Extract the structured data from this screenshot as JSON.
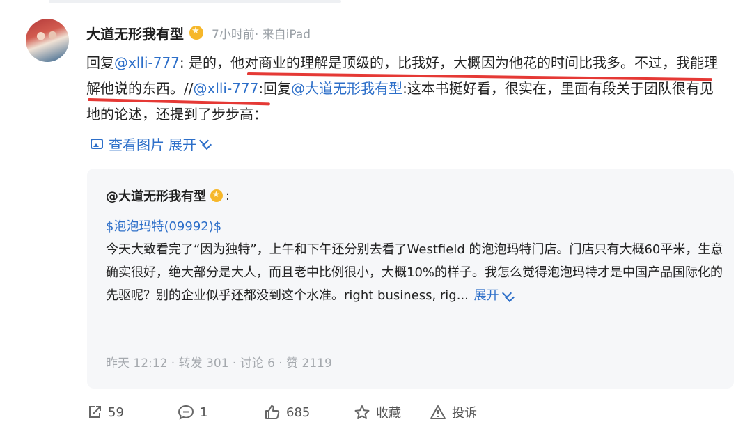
{
  "post": {
    "author": "大道无形我有型",
    "meta": "7小时前· 来自iPad",
    "reply_prefix": "回复",
    "mention_1": "@xlli-777",
    "text_1": ": 是的，",
    "underlined_1": "他对商业的理解是顶级的，比我好，大概因为他花的时间比我多。",
    "underlined_2": "不过，我能理解他说的东西",
    "text_2": "。//",
    "mention_2": "@xlli-777",
    "text_3": ":回复",
    "mention_3": "@大道无形我有型",
    "text_4": ":这本书挺好看，很实在，里面有段关于团队很有见地的论述，还提到了步步高：",
    "view_images": "查看图片",
    "expand": "展开"
  },
  "quoted": {
    "author": "@大道无形我有型",
    "colon": ":",
    "stock_tag": "$泡泡玛特(09992)$",
    "body": "今天大致看完了“因为独特”，上午和下午还分别去看了Westfield 的泡泡玛特门店。门店只有大概60平米，生意确实很好，绝大部分是大人，而且老中比例很小，大概10%的样子。我怎么觉得泡泡玛特才是中国产品国际化的先驱呢？别的企业似乎还都没到这个水准。right business, rig...",
    "expand": "展开",
    "footer": "昨天 12:12 · 转发 301 · 讨论 6 · 赞 2119"
  },
  "actions": {
    "share_count": "59",
    "comment_count": "1",
    "like_count": "685",
    "favorite_label": "收藏",
    "report_label": "投诉"
  },
  "colors": {
    "link": "#2d6fc9",
    "underline": "#e53935",
    "card_bg": "#f6f7f9"
  }
}
